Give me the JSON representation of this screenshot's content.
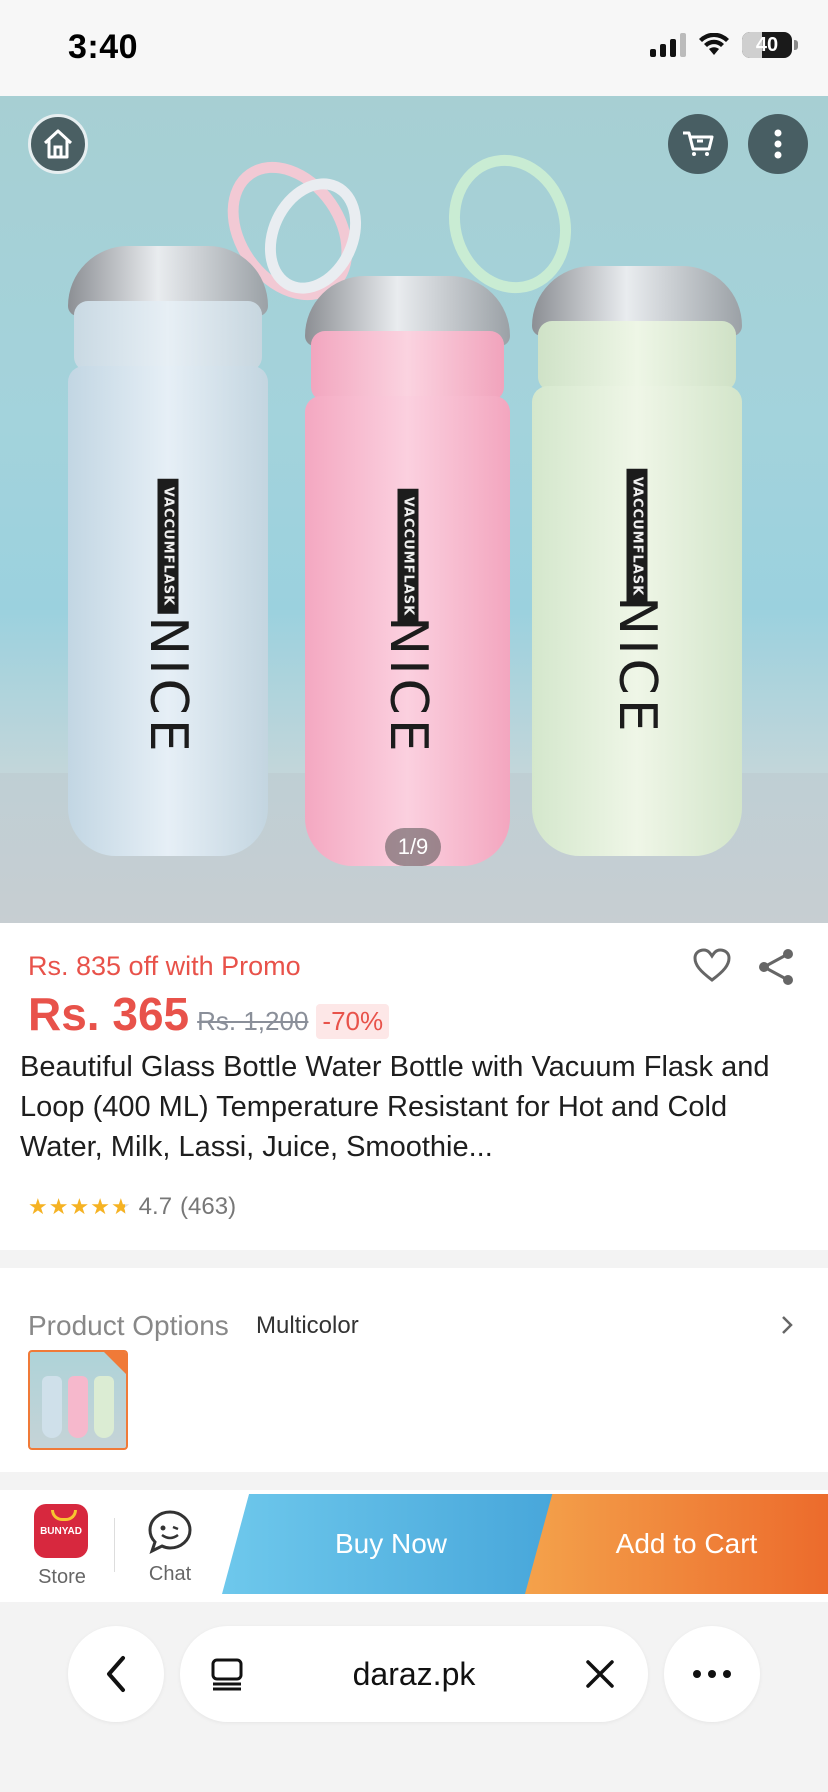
{
  "status_bar": {
    "time": "3:40",
    "battery": "40",
    "battery_level": 0.4
  },
  "gallery": {
    "counter": "1/9",
    "bottle_brand": "VACCUMFLASK",
    "bottle_logo": "NICE"
  },
  "product": {
    "promo": "Rs. 835 off with Promo",
    "price": "Rs. 365",
    "original_price": "Rs. 1,200",
    "discount": "-70%",
    "title": "Beautiful Glass Bottle Water Bottle with Vacuum Flask and Loop (400 ML) Temperature Resistant for Hot and Cold Water, Milk, Lassi, Juice, Smoothie...",
    "rating": "4.7",
    "reviews": "(463)",
    "rating_value": 4.7
  },
  "options": {
    "label": "Product Options",
    "value": "Multicolor"
  },
  "actions": {
    "store_label": "Store",
    "store_logo": "BUNYAD",
    "chat_label": "Chat",
    "buy_now": "Buy Now",
    "add_to_cart": "Add to Cart"
  },
  "browser": {
    "url": "daraz.pk"
  },
  "colors": {
    "price_red": "#e8524a",
    "buy_blue": "#47a6da",
    "cart_orange": "#ec6b2c",
    "thumb_border": "#f07a38"
  },
  "icons": [
    "home-icon",
    "cart-icon",
    "more-vertical-icon",
    "heart-icon",
    "share-icon",
    "star-icon",
    "chevron-right-icon",
    "chat-icon",
    "back-icon",
    "tabs-icon",
    "close-icon",
    "more-horizontal-icon"
  ]
}
